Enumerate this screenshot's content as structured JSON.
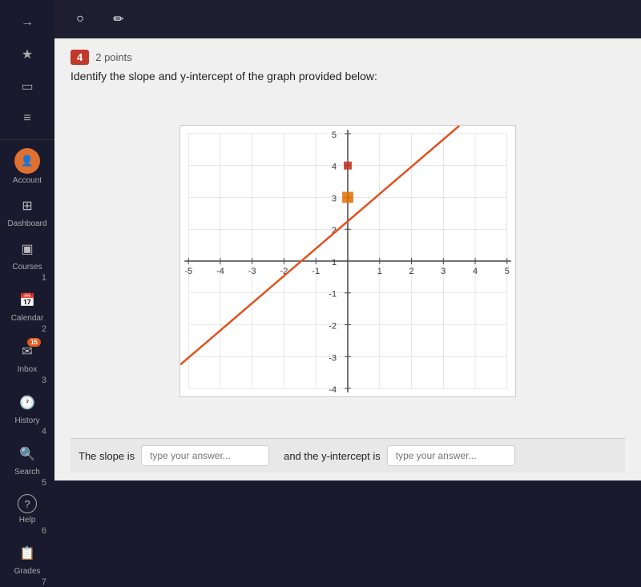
{
  "sidebar": {
    "collapse_icon": "→",
    "items": [
      {
        "id": "account",
        "label": "Account",
        "type": "avatar",
        "content": "👤"
      },
      {
        "id": "dashboard",
        "label": "Dashboard",
        "type": "icon",
        "content": "⊞"
      },
      {
        "id": "courses",
        "label": "Courses",
        "type": "icon",
        "content": "▣"
      },
      {
        "id": "calendar",
        "label": "Calendar",
        "type": "icon",
        "content": "⊞"
      },
      {
        "id": "inbox",
        "label": "Inbox",
        "type": "icon",
        "content": "✉",
        "badge": "15"
      },
      {
        "id": "history",
        "label": "History",
        "type": "icon",
        "content": "🕐"
      },
      {
        "id": "search",
        "label": "Search",
        "type": "icon",
        "content": "🔍"
      },
      {
        "id": "help",
        "label": "Help",
        "type": "icon",
        "content": "?"
      },
      {
        "id": "grades",
        "label": "Grades",
        "type": "icon",
        "content": "📋"
      }
    ],
    "row_numbers": [
      "1",
      "2",
      "3",
      "4",
      "5",
      "6",
      "7"
    ]
  },
  "topbar": {
    "pencil_icon": "✏",
    "circle_icon": "○"
  },
  "question": {
    "number": "4",
    "points": "2 points",
    "text": "Identify the slope and y-intercept of the graph provided below:"
  },
  "answer": {
    "slope_label": "The slope is",
    "slope_placeholder": "type your answer...",
    "intercept_label": "and the y-intercept is",
    "intercept_placeholder": "type your answer..."
  }
}
